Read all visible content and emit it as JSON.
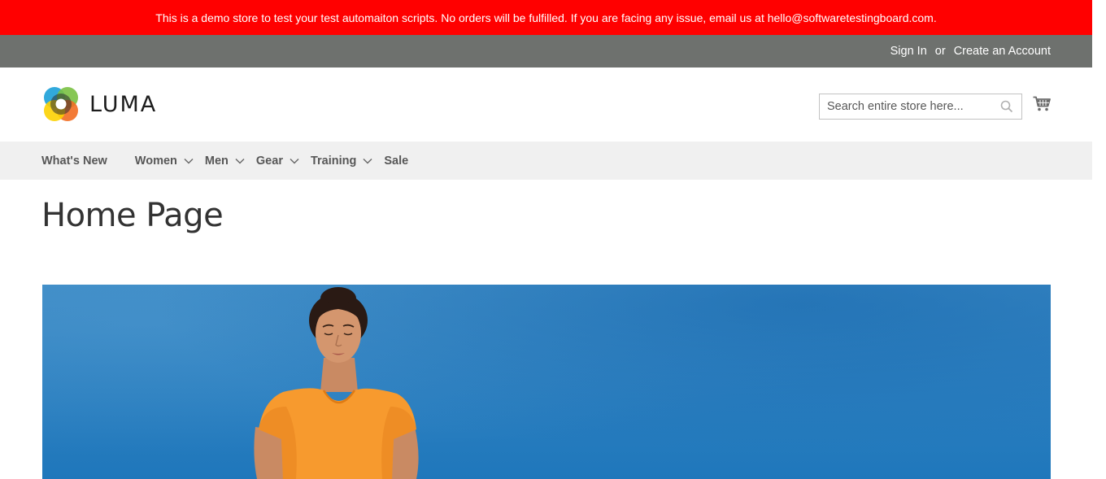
{
  "notice": {
    "text": "This is a demo store to test your test automaiton scripts. No orders will be fulfilled. If you are facing any issue, email us at hello@softwaretestingboard.com."
  },
  "panel": {
    "sign_in": "Sign In",
    "or": "or",
    "create_account": "Create an Account"
  },
  "header": {
    "logo_text": "LUMA",
    "search_placeholder": "Search entire store here...",
    "search_icon": "search-icon",
    "cart_icon": "cart-icon"
  },
  "nav": {
    "items": [
      {
        "label": "What's New",
        "has_submenu": false
      },
      {
        "label": "Women",
        "has_submenu": true
      },
      {
        "label": "Men",
        "has_submenu": true
      },
      {
        "label": "Gear",
        "has_submenu": true
      },
      {
        "label": "Training",
        "has_submenu": true
      },
      {
        "label": "Sale",
        "has_submenu": false
      }
    ]
  },
  "main": {
    "title": "Home Page"
  },
  "colors": {
    "notice_bg": "#ff0000",
    "panel_bg": "#6e716e",
    "nav_bg": "#f0f0f0",
    "hero_sky": "#2f82c2",
    "shirt": "#f79a2e"
  }
}
